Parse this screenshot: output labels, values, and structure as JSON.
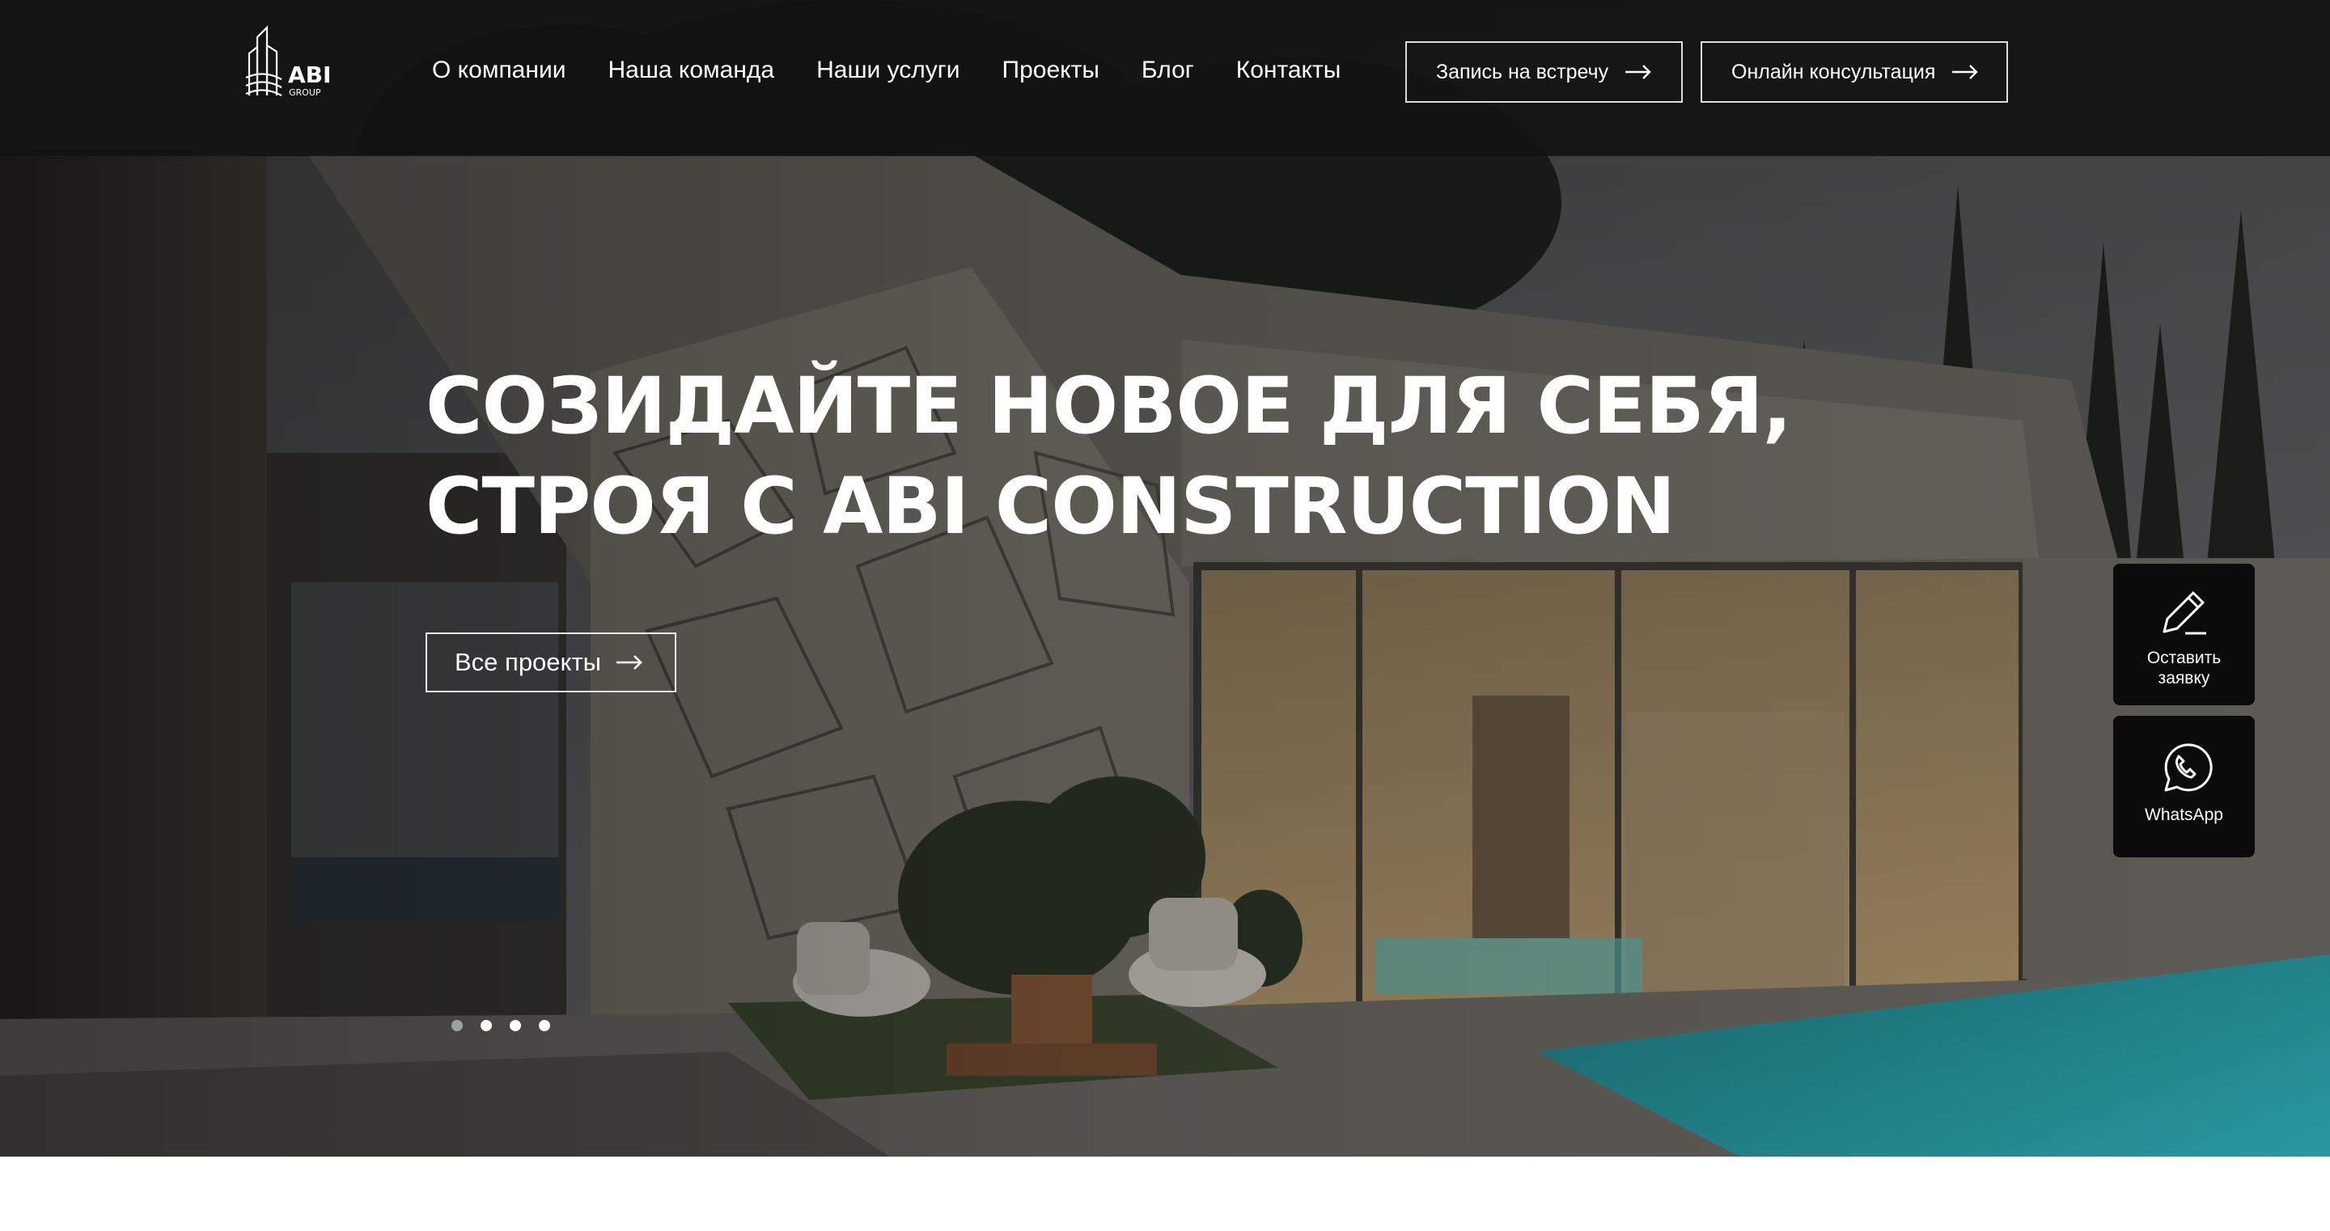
{
  "brand": {
    "logo_text": "ABI",
    "logo_subtext": "GROUP"
  },
  "nav": {
    "items": [
      {
        "label": "О компании"
      },
      {
        "label": "Наша команда"
      },
      {
        "label": "Наши услуги"
      },
      {
        "label": "Проекты"
      },
      {
        "label": "Блог"
      },
      {
        "label": "Контакты"
      }
    ]
  },
  "header_buttons": {
    "meeting": "Запись на встречу",
    "consultation": "Онлайн консультация"
  },
  "hero": {
    "title_line1": "Созидайте новое для себя,",
    "title_line2": "строя с ABI Construction",
    "cta": "Все проекты",
    "slides": 4,
    "active_slide": 1
  },
  "widgets": {
    "request_line1": "Оставить",
    "request_line2": "заявку",
    "whatsapp": "WhatsApp"
  },
  "icons": {
    "logo": "abi-building-logo",
    "arrow": "arrow-right-icon",
    "request": "pencil-icon",
    "whatsapp": "whatsapp-icon"
  }
}
